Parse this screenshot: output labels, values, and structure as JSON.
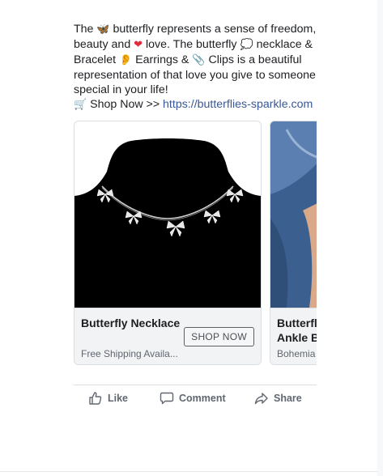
{
  "post": {
    "l1_a": "The ",
    "l1_emoji": "🦋",
    "l1_b": " butterfly represents a sense of freedom,",
    "l2_a": "beauty and ",
    "l2_emoji": "❤",
    "l2_b": " love. The butterfly ",
    "l2_emoji2": "💭",
    "l2_c": " necklace &",
    "l3_a": "Bracelet ",
    "l3_emoji": "👂",
    "l3_b": " Earrings & ",
    "l3_emoji2": "📎",
    "l3_c": " Clips is a beautiful",
    "l4": "representation of that love you give to someone",
    "l5": "special in your life!",
    "l6_emoji": "🛒",
    "l6_a": " Shop Now >> ",
    "l6_link": "https://butterflies-sparkle.com"
  },
  "cards": [
    {
      "title": "Butterfly Necklace",
      "subtitle": "Free Shipping Availa...",
      "button": "SHOP NOW"
    },
    {
      "title": "Butterfly Ankle B",
      "subtitle": "Bohemia"
    }
  ],
  "actions": {
    "like": "Like",
    "comment": "Comment",
    "share": "Share"
  },
  "colors": {
    "link": "#385898",
    "action_text": "#606770",
    "card_info_bg": "#f2f3f5"
  }
}
